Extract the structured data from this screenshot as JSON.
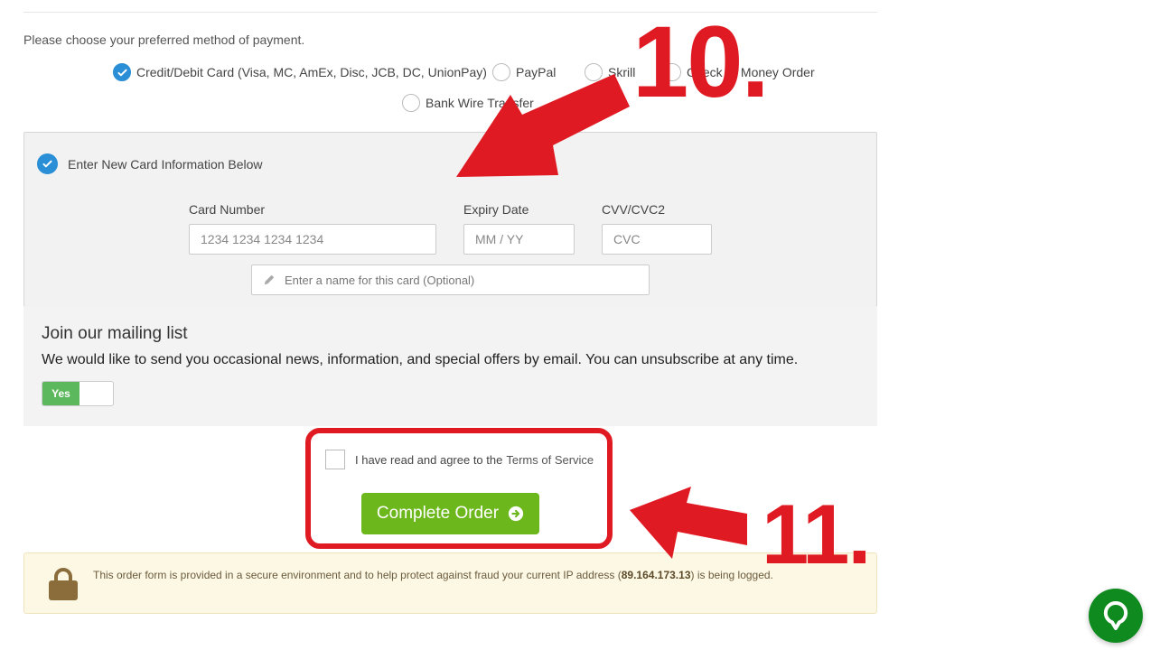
{
  "payment": {
    "prompt": "Please choose your preferred method of payment.",
    "methods": [
      {
        "label": "Credit/Debit Card (Visa, MC, AmEx, Disc, JCB, DC, UnionPay)",
        "selected": true
      },
      {
        "label": "PayPal",
        "selected": false
      },
      {
        "label": "Skrill",
        "selected": false
      },
      {
        "label": "Check or Money Order",
        "selected": false
      },
      {
        "label": "Bank Wire Transfer",
        "selected": false
      }
    ]
  },
  "card": {
    "new_card_label": "Enter New Card Information Below",
    "number_label": "Card Number",
    "number_placeholder": "1234 1234 1234 1234",
    "expiry_label": "Expiry Date",
    "expiry_placeholder": "MM / YY",
    "cvv_label": "CVV/CVC2",
    "cvv_placeholder": "CVC",
    "name_placeholder": "Enter a name for this card (Optional)"
  },
  "mailing": {
    "title": "Join our mailing list",
    "description": "We would like to send you occasional news, information, and special offers by email. You can unsubscribe at any time.",
    "toggle_label": "Yes"
  },
  "tos": {
    "prefix": "I have read and agree to the",
    "link": "Terms of Service"
  },
  "order": {
    "button_label": "Complete Order"
  },
  "secure": {
    "text_before": "This order form is provided in a secure environment and to help protect against fraud your current IP address (",
    "ip": "89.164.173.13",
    "text_after": ") is being logged."
  },
  "annotations": {
    "step_a": "10.",
    "step_b": "11."
  },
  "colors": {
    "accent_blue": "#2a8fd6",
    "order_green": "#6cb81c",
    "annotation_red": "#e01a22",
    "chat_green": "#0f8a1f"
  },
  "icons": {
    "check": "check-icon",
    "pencil": "pencil-icon",
    "arrow": "arrow-circle-right-icon",
    "lock": "lock-icon",
    "chat": "chat-bubble-icon"
  }
}
